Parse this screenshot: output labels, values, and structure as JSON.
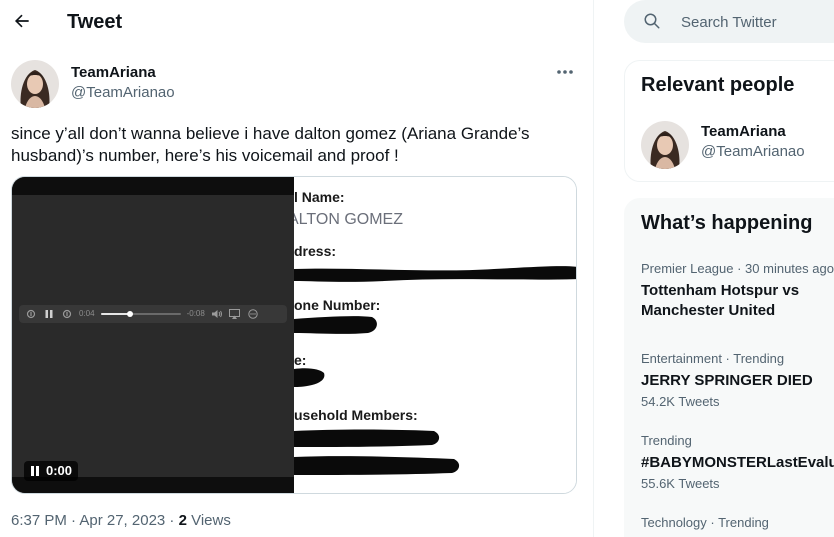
{
  "header": {
    "title": "Tweet",
    "back_icon": "arrow-left-icon"
  },
  "tweet": {
    "author_name": "TeamAriana",
    "author_handle": "@TeamArianao",
    "more_icon": "more-horizontal-icon",
    "text": "since y’all don’t wanna believe i have dalton gomez (Ariana Grande’s husband)’s number, here’s his voicemail and proof !",
    "media": {
      "video": {
        "elapsed": "0:04",
        "remaining": "-0:08",
        "progress_fraction": 0.37,
        "pill_time": "0:00"
      },
      "document": {
        "name_label": "l Name:",
        "name_value": "ALTON GOMEZ",
        "address_label": "dress:",
        "phone_label": "one Number:",
        "age_label": "e:",
        "household_label": "usehold Members:"
      }
    },
    "timestamp": "6:37 PM · Apr 27, 2023 · ",
    "views_count": "2",
    "views_label": " Views"
  },
  "sidebar": {
    "search": {
      "placeholder": "Search Twitter"
    },
    "relevant_people": {
      "title": "Relevant people",
      "person": {
        "name": "TeamAriana",
        "handle": "@TeamArianao"
      }
    },
    "whats_happening": {
      "title": "What’s happening",
      "trends": [
        {
          "context": "Premier League · 30 minutes ago",
          "title": "Tottenham Hotspur vs",
          "title2": "Manchester United",
          "count": ""
        },
        {
          "context": "Entertainment · Trending",
          "title": "JERRY SPRINGER DIED",
          "title2": "",
          "count": "54.2K Tweets"
        },
        {
          "context": "Trending",
          "title": "#BABYMONSTERLastEvaluation",
          "title2": "",
          "count": "55.6K Tweets"
        },
        {
          "context": "Technology · Trending",
          "title": "",
          "title2": "",
          "count": ""
        }
      ]
    }
  },
  "colors": {
    "text_primary": "#0f1419",
    "text_secondary": "#536471",
    "border": "#cfd9de",
    "search_bg": "#eff3f4"
  }
}
